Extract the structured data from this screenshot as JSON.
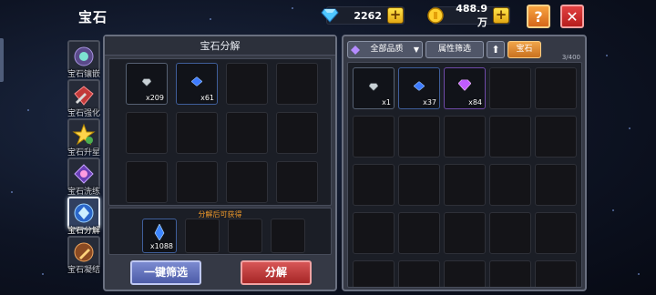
{
  "header": {
    "title": "宝石",
    "diamonds": "2262",
    "gold": "488.9万",
    "help_label": "?",
    "close_label": "✕"
  },
  "menu": {
    "items": [
      {
        "label": "宝石镶嵌",
        "icon": "gem-inlay-icon"
      },
      {
        "label": "宝石强化",
        "icon": "gem-enhance-icon"
      },
      {
        "label": "宝石升星",
        "icon": "gem-star-up-icon"
      },
      {
        "label": "宝石洗练",
        "icon": "gem-refine-icon"
      },
      {
        "label": "宝石分解",
        "icon": "gem-decompose-icon",
        "active": true
      },
      {
        "label": "宝石凝结",
        "icon": "gem-condense-icon"
      }
    ]
  },
  "decompose": {
    "title": "宝石分解",
    "slots": [
      {
        "count": "x209",
        "gem": "gray"
      },
      {
        "count": "x61",
        "gem": "blue"
      },
      {},
      {},
      {},
      {},
      {},
      {},
      {},
      {},
      {},
      {}
    ],
    "result_label": "分解后可获得",
    "result_slots": [
      {
        "count": "x1088",
        "gem": "crystal"
      },
      {},
      {},
      {}
    ],
    "filter_button": "一键筛选",
    "decompose_button": "分解"
  },
  "inventory": {
    "quality_dropdown": "全部品质",
    "attribute_filter": "属性筛选",
    "sort_icon": "arrow-up-icon",
    "gem_tab": "宝石",
    "capacity": "3/400",
    "slots": [
      {
        "count": "x1",
        "gem": "gray"
      },
      {
        "count": "x37",
        "gem": "blue"
      },
      {
        "count": "x84",
        "gem": "purple"
      },
      {},
      {},
      {},
      {},
      {},
      {},
      {},
      {},
      {},
      {},
      {},
      {},
      {},
      {},
      {},
      {},
      {},
      {},
      {},
      {},
      {},
      {}
    ]
  },
  "colors": {
    "accent_orange": "#f09a2a",
    "blue_button": "#5c6bb8",
    "red_button": "#b83434",
    "gold_plus": "#ffd02e"
  }
}
